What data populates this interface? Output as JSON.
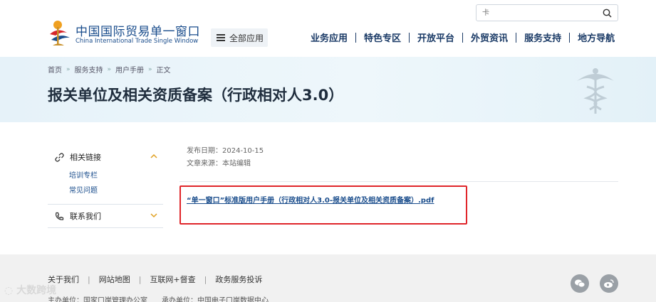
{
  "header": {
    "logo_cn": "中国国际贸易单一窗口",
    "logo_en": "China International Trade Single Window",
    "menu_label": "全部应用",
    "search_placeholder": "卡",
    "nav": [
      "业务应用",
      "特色专区",
      "开放平台",
      "外贸资讯",
      "服务支持",
      "地方导航"
    ]
  },
  "breadcrumb": [
    "首页",
    "服务支持",
    "用户手册",
    "正文"
  ],
  "page_title": "报关单位及相关资质备案（行政相对人3.0）",
  "sidebar": {
    "groups": [
      {
        "label": "相关链接",
        "icon": "link-icon",
        "expanded": true,
        "items": [
          "培训专栏",
          "常见问题"
        ]
      },
      {
        "label": "联系我们",
        "icon": "phone-icon",
        "expanded": false,
        "items": []
      }
    ]
  },
  "article": {
    "publish_date": "发布日期：2024-10-15",
    "source": "文章来源：本站编辑",
    "file_link": "“单一窗口”标准版用户手册（行政相对人3.0-报关单位及相关资质备案）.pdf"
  },
  "footer": {
    "links": [
      "关于我们",
      "网站地图",
      "互联网+督查",
      "政务服务投诉"
    ],
    "host": "主办单位：国家口岸管理办公室",
    "organizer": "承办单位：中国电子口岸数据中心"
  },
  "watermark": "大数跨境",
  "colors": {
    "brand": "#1a4d8c",
    "nav": "#1a3a66",
    "highlight": "#e0252a",
    "banner": "#e6f2f9"
  }
}
